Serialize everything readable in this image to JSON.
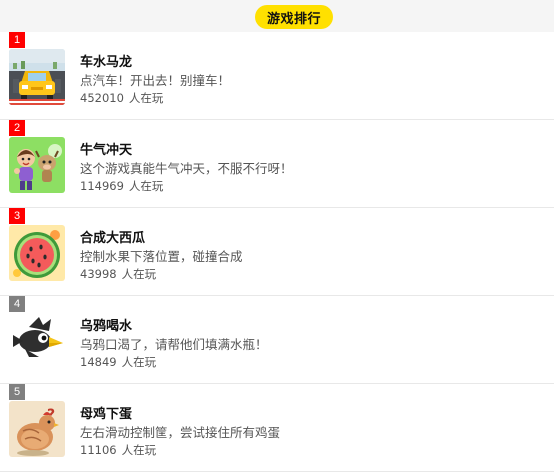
{
  "header": {
    "title": "游戏排行"
  },
  "colors": {
    "accent": "#ffe000",
    "rank_top": "#ff0000",
    "rank_other": "#808080"
  },
  "games": [
    {
      "rank": "1",
      "rank_color": "#ff0000",
      "title": "车水马龙",
      "desc": "点汽车！开出去！别撞车！",
      "plays": "452010",
      "plays_label": "人在玩",
      "icon": "yellow-car-icon"
    },
    {
      "rank": "2",
      "rank_color": "#ff0000",
      "title": "牛气冲天",
      "desc": "这个游戏真能牛气冲天，不服不行呀！",
      "plays": "114969",
      "plays_label": "人在玩",
      "icon": "girl-and-cow-icon"
    },
    {
      "rank": "3",
      "rank_color": "#ff0000",
      "title": "合成大西瓜",
      "desc": "控制水果下落位置，碰撞合成",
      "plays": "43998",
      "plays_label": "人在玩",
      "icon": "watermelon-icon"
    },
    {
      "rank": "4",
      "rank_color": "#808080",
      "title": "乌鸦喝水",
      "desc": "乌鸦口渴了，请帮他们填满水瓶！",
      "plays": "14849",
      "plays_label": "人在玩",
      "icon": "crow-icon"
    },
    {
      "rank": "5",
      "rank_color": "#808080",
      "title": "母鸡下蛋",
      "desc": "左右滑动控制筐，尝试接住所有鸡蛋",
      "plays": "11106",
      "plays_label": "人在玩",
      "icon": "hen-icon"
    }
  ]
}
